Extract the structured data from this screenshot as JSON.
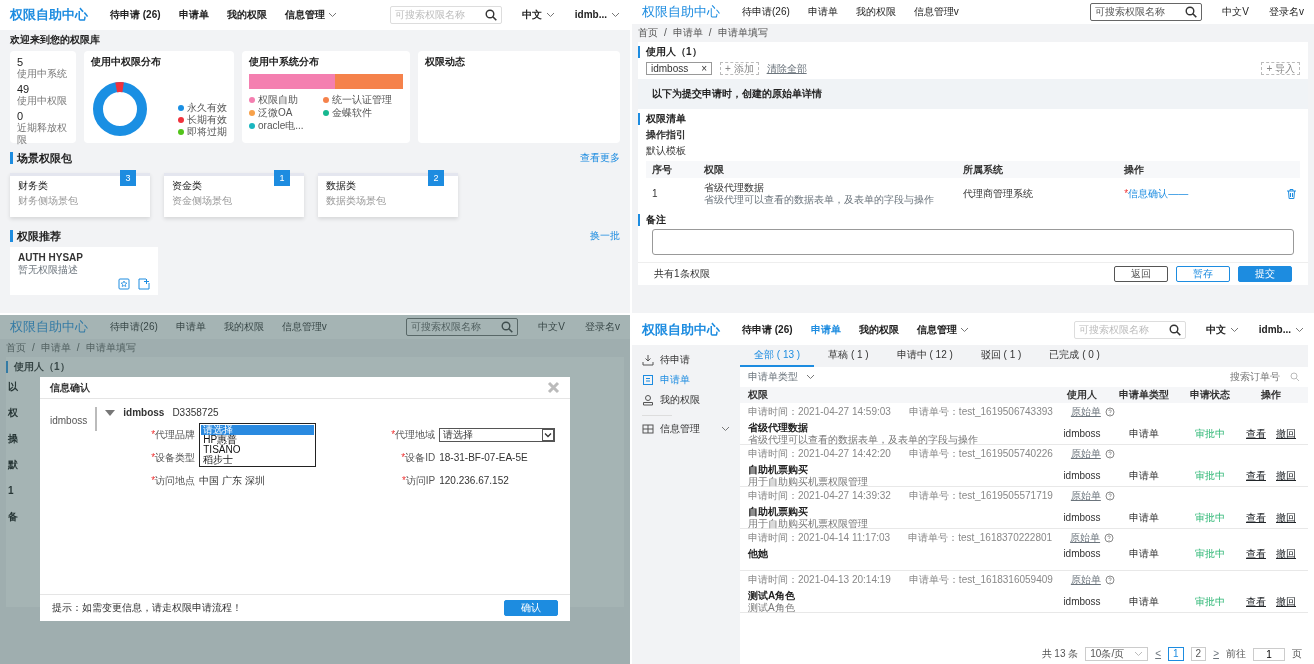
{
  "dashboard": {
    "header": {
      "kind": "modern",
      "title": "权限自助中心",
      "nav": [
        {
          "label": "待申请 (26)",
          "selected": false,
          "dropdown": false
        },
        {
          "label": "申请单",
          "selected": false,
          "dropdown": false
        },
        {
          "label": "我的权限",
          "selected": false,
          "dropdown": false
        },
        {
          "label": "信息管理",
          "selected": false,
          "dropdown": true
        }
      ],
      "search": {
        "placeholder": "可搜索权限名称"
      },
      "language": {
        "label": "中文",
        "dropdown": true
      },
      "user": {
        "label": "idmb...",
        "dropdown": true
      }
    },
    "welcome": "欢迎来到您的权限库",
    "stats": [
      {
        "value": "5",
        "label": "使用中系统"
      },
      {
        "value": "49",
        "label": "使用中权限"
      },
      {
        "value": "0",
        "label": "近期释放权限"
      }
    ],
    "permission_distribution": {
      "title": "使用中权限分布",
      "legend": [
        {
          "label": "永久有效",
          "color": "#1a8fe3"
        },
        {
          "label": "长期有效",
          "color": "#f0323c"
        },
        {
          "label": "即将过期",
          "color": "#52c41a"
        }
      ]
    },
    "system_distribution": {
      "title": "使用中系统分布",
      "legend": [
        {
          "label": "权限自助",
          "color": "#f47fb0"
        },
        {
          "label": "统一认证管理",
          "color": "#f5824b"
        },
        {
          "label": "泛微OA",
          "color": "#f7a14a"
        },
        {
          "label": "金蝶软件",
          "color": "#17b890"
        },
        {
          "label": "oracle电...",
          "color": "#1ab6c0"
        }
      ]
    },
    "activity": {
      "title": "权限动态"
    },
    "scene_packages": {
      "title": "场景权限包",
      "more_link": "查看更多",
      "items": [
        {
          "name": "财务类",
          "desc": "财务侧场景包",
          "count": "3"
        },
        {
          "name": "资金类",
          "desc": "资金侧场景包",
          "count": "1"
        },
        {
          "name": "数据类",
          "desc": "数据类场景包",
          "count": "2"
        }
      ]
    },
    "recommendations": {
      "title": "权限推荐",
      "refresh_link": "换一批",
      "items": [
        {
          "name": "AUTH HYSAP",
          "desc": "暂无权限描述"
        }
      ]
    }
  },
  "application_form": {
    "header": {
      "kind": "classic",
      "title": "权限自助中心",
      "nav": [
        {
          "label": "待申请(26)",
          "selected": false,
          "dropdown": false
        },
        {
          "label": "申请单",
          "selected": false,
          "dropdown": false
        },
        {
          "label": "我的权限",
          "selected": false,
          "dropdown": false
        },
        {
          "label": "信息管理v",
          "selected": false,
          "dropdown": false
        }
      ],
      "search": {
        "placeholder": "可搜索权限名称"
      },
      "language": {
        "label": "中文V",
        "dropdown": false
      },
      "user": {
        "label": "登录名v",
        "dropdown": false
      }
    },
    "breadcrumb": {
      "separator": "/",
      "items": [
        "首页",
        "申请单",
        "申请单填写"
      ]
    },
    "users": {
      "title": "使用人（1）",
      "tags": [
        {
          "label": "idmboss",
          "remove": "×"
        }
      ],
      "add_button": "+ 添加",
      "clear_link": "清除全部",
      "import_button": "+ 导入"
    },
    "notice": "以下为提交申请时，创建的原始单详情",
    "permission_list": {
      "title": "权限清单",
      "guide": "操作指引",
      "template": "默认模板",
      "columns": [
        "序号",
        "权限",
        "所属系统",
        "操作"
      ],
      "rows": [
        {
          "index": "1",
          "name": "省级代理数据",
          "desc": "省级代理可以查看的数据表单，及表单的字段与操作",
          "system": "代理商管理系统",
          "required_mark": "*",
          "action": "信息确认——"
        }
      ]
    },
    "remarks": {
      "title": "备注"
    },
    "footer": {
      "summary": "共有1条权限",
      "buttons": [
        {
          "label": "返回",
          "kind": "default"
        },
        {
          "label": "暂存",
          "kind": "outline"
        },
        {
          "label": "提交",
          "kind": "primary"
        }
      ]
    }
  },
  "info_dialog_screen": {
    "header": {
      "kind": "classic",
      "title": "权限自助中心",
      "nav": [
        {
          "label": "待申请(26)",
          "selected": false,
          "dropdown": false
        },
        {
          "label": "申请单",
          "selected": false,
          "dropdown": false
        },
        {
          "label": "我的权限",
          "selected": false,
          "dropdown": false
        },
        {
          "label": "信息管理v",
          "selected": false,
          "dropdown": false
        }
      ],
      "search": {
        "placeholder": "可搜索权限名称"
      },
      "language": {
        "label": "中文V",
        "dropdown": false
      },
      "user": {
        "label": "登录名v",
        "dropdown": false
      }
    },
    "breadcrumb": {
      "separator": "/",
      "items": [
        "首页",
        "申请单",
        "申请单填写"
      ]
    },
    "users_title": "使用人（1）",
    "background_fragments": [
      "以",
      "权",
      "操",
      "默",
      "1",
      "备"
    ],
    "dialog": {
      "title": "信息确认",
      "user_label": "idmboss",
      "account": {
        "name": "idmboss",
        "id": "D3358725",
        "expanded": true
      },
      "fields": [
        {
          "label": "代理品牌",
          "required_mark": "*",
          "kind": "listbox",
          "options": [
            {
              "label": "请选择",
              "selected": true
            },
            {
              "label": "HP惠普",
              "selected": false
            },
            {
              "label": "TISANO",
              "selected": false
            },
            {
              "label": "稻步士",
              "selected": false
            }
          ]
        },
        {
          "label": "代理地域",
          "required_mark": "*",
          "kind": "select",
          "value": "请选择"
        },
        {
          "label": "设备类型",
          "required_mark": "*",
          "kind": "text"
        },
        {
          "label": "设备ID",
          "required_mark": "*",
          "kind": "text",
          "value": "18-31-BF-07-EA-5E"
        },
        {
          "label": "访问地点",
          "required_mark": "*",
          "kind": "text",
          "value": "中国 广东 深圳"
        },
        {
          "label": "访问IP",
          "required_mark": "*",
          "kind": "text",
          "value": "120.236.67.152"
        }
      ],
      "tip": "提示：如需变更信息，请走权限申请流程！",
      "confirm_button": "确认"
    }
  },
  "application_list": {
    "header": {
      "kind": "modern",
      "title": "权限自助中心",
      "nav": [
        {
          "label": "待申请 (26)",
          "selected": false,
          "dropdown": false
        },
        {
          "label": "申请单",
          "selected": true,
          "dropdown": false
        },
        {
          "label": "我的权限",
          "selected": false,
          "dropdown": false
        },
        {
          "label": "信息管理",
          "selected": false,
          "dropdown": true
        }
      ],
      "search": {
        "placeholder": "可搜索权限名称"
      },
      "language": {
        "label": "中文",
        "dropdown": true
      },
      "user": {
        "label": "idmb...",
        "dropdown": true
      }
    },
    "sidebar": [
      {
        "label": "待申请",
        "selected": false,
        "expandable": false
      },
      {
        "label": "申请单",
        "selected": true,
        "expandable": false
      },
      {
        "label": "我的权限",
        "selected": false,
        "expandable": false
      },
      {
        "label": "信息管理",
        "selected": false,
        "expandable": true
      }
    ],
    "tabs": [
      {
        "label": "全部 ( 13 )",
        "selected": true
      },
      {
        "label": "草稿 ( 1 )",
        "selected": false
      },
      {
        "label": "申请中 ( 12 )",
        "selected": false
      },
      {
        "label": "驳回 ( 1 )",
        "selected": false
      },
      {
        "label": "已完成 ( 0 )",
        "selected": false
      }
    ],
    "filter": {
      "label": "申请单类型",
      "search_placeholder": "搜索订单号"
    },
    "columns": [
      "权限",
      "使用人",
      "申请单类型",
      "申请状态",
      "操作"
    ],
    "rows": [
      {
        "time": "申请时间：2021-04-27 14:59:03",
        "number": "申请单号：test_1619506743393",
        "origin": "原始单",
        "title": "省级代理数据",
        "desc": "省级代理可以查看的数据表单，及表单的字段与操作",
        "user": "idmboss",
        "type": "申请单",
        "status": "审批中",
        "actions": [
          "查看",
          "撤回"
        ]
      },
      {
        "time": "申请时间：2021-04-27 14:42:20",
        "number": "申请单号：test_1619505740226",
        "origin": "原始单",
        "title": "自助机票购买",
        "desc": "用于自助购买机票权限管理",
        "user": "idmboss",
        "type": "申请单",
        "status": "审批中",
        "actions": [
          "查看",
          "撤回"
        ]
      },
      {
        "time": "申请时间：2021-04-27 14:39:32",
        "number": "申请单号：test_1619505571719",
        "origin": "原始单",
        "title": "自助机票购买",
        "desc": "用于自助购买机票权限管理",
        "user": "idmboss",
        "type": "申请单",
        "status": "审批中",
        "actions": [
          "查看",
          "撤回"
        ]
      },
      {
        "time": "申请时间：2021-04-14 11:17:03",
        "number": "申请单号：test_1618370222801",
        "origin": "原始单",
        "title": "他她",
        "user": "idmboss",
        "type": "申请单",
        "status": "审批中",
        "actions": [
          "查看",
          "撤回"
        ]
      },
      {
        "time": "申请时间：2021-04-13 20:14:19",
        "number": "申请单号：test_1618316059409",
        "origin": "原始单",
        "title": "测试A角色",
        "desc": "测试A角色",
        "user": "idmboss",
        "type": "申请单",
        "status": "审批中",
        "actions": [
          "查看",
          "撤回"
        ]
      }
    ],
    "pagination": {
      "total": "共 13 条",
      "page_size": "10条/页",
      "prev": "<",
      "pages": [
        {
          "label": "1",
          "selected": true
        },
        {
          "label": "2",
          "selected": false
        }
      ],
      "next": ">",
      "goto_label": "前往",
      "goto_value": "1",
      "goto_suffix": "页"
    }
  }
}
